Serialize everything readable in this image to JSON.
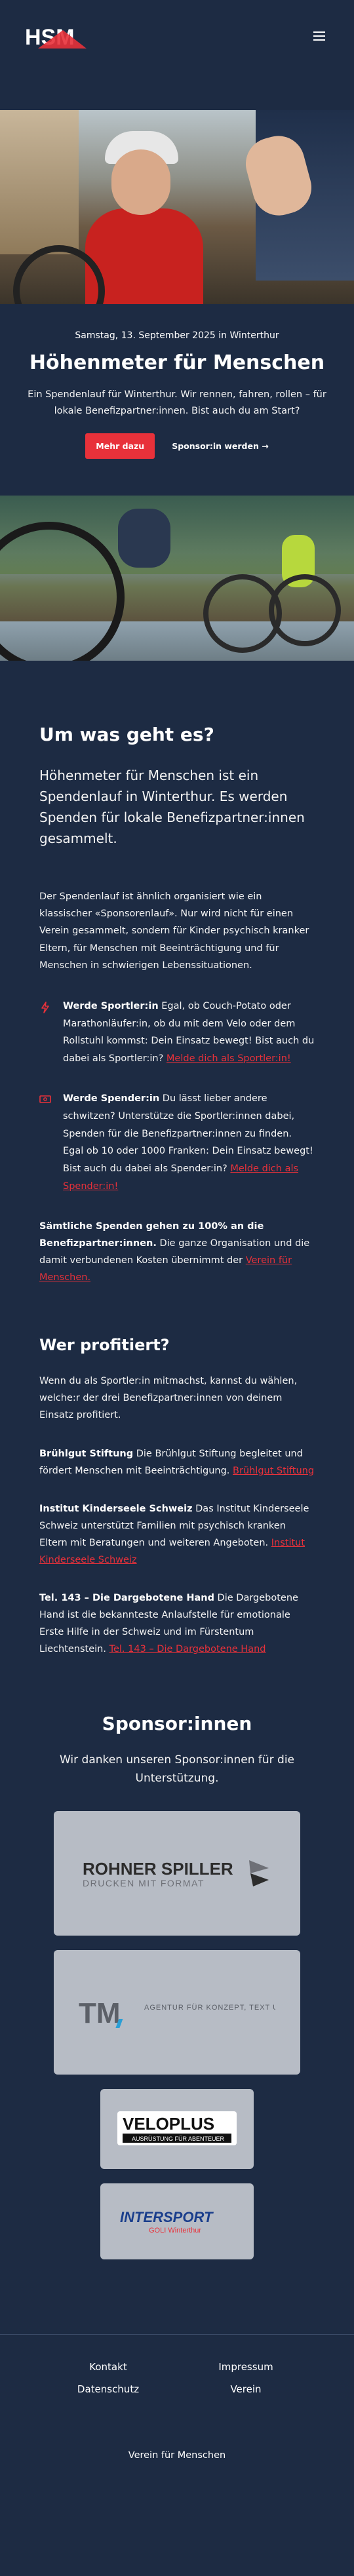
{
  "header": {
    "logo_text": "HSM",
    "menu_icon": "menu-icon"
  },
  "hero": {
    "date": "Samstag, 13. September 2025 in Winterthur",
    "title": "Höhenmeter für Menschen",
    "description": "Ein Spendenlauf für Winterthur. Wir rennen, fahren, rollen – für lokale Benefizpartner:innen. Bist auch du am Start?",
    "primary_cta": "Mehr dazu",
    "secondary_cta": "Sponsor:in werden →"
  },
  "intro": {
    "heading": "Um was geht es?",
    "lead": "Höhenmeter für Menschen ist ein Spendenlauf in Winterthur. Es werden Spenden für lokale Benefizpartner:innen gesammelt.",
    "paragraph": "Der Spendenlauf ist ähnlich organisiert wie ein klassischer «Sponsorenlauf». Nur wird nicht für einen Verein gesammelt, sondern für Kinder psychisch kranker Eltern, für Menschen mit Beeinträchtigung und für Menschen in schwierigen Lebenssituationen.",
    "features": [
      {
        "icon": "lightning-icon",
        "title": "Werde Sportler:in",
        "text": " Egal, ob Couch-Potato oder Marathonläufer:in, ob du mit dem Velo oder dem Rollstuhl kommst: Dein Einsatz bewegt! Bist auch du dabei als Sportler:in? ",
        "link": "Melde dich als Sportler:in!"
      },
      {
        "icon": "money-icon",
        "title": "Werde Spender:in",
        "text": " Du lässt lieber andere schwitzen? Unterstütze die Sportler:innen dabei, Spenden für die Benefizpartner:innen zu finden. Egal ob 10 oder 1000 Franken: Dein Einsatz bewegt! Bist auch du dabei als Spender:in? ",
        "link": "Melde dich als Spender:in!"
      }
    ],
    "note_bold": "Sämtliche Spenden gehen zu 100% an die Benefizpartner:innen.",
    "note_text": " Die ganze Organisation und die damit verbundenen Kosten übernimmt der ",
    "note_link": "Verein für Menschen."
  },
  "beneficiaries": {
    "heading": "Wer profitiert?",
    "intro": "Wenn du als Sportler:in mitmachst, kannst du wählen, welche:r der drei Benefizpartner:innen von deinem Einsatz profitiert.",
    "items": [
      {
        "name": "Brühlgut Stiftung",
        "text": " Die Brühlgut Stiftung begleitet und fördert Menschen mit Beeinträchtigung. ",
        "link": "Brühlgut Stiftung"
      },
      {
        "name": "Institut Kinderseele Schweiz",
        "text": " Das Institut Kinderseele Schweiz unterstützt Familien mit psychisch kranken Eltern mit Beratungen und weiteren Angeboten. ",
        "link": "Institut Kinderseele Schweiz"
      },
      {
        "name": "Tel. 143 – Die Dargebotene Hand",
        "text": " Die Dargebotene Hand ist die bekannteste Anlaufstelle für emotionale Erste Hilfe in der Schweiz und im Fürstentum Liechtenstein. ",
        "link": "Tel. 143 – Die Dargebotene Hand"
      }
    ]
  },
  "sponsors": {
    "heading": "Sponsor:innen",
    "subtitle": "Wir danken unseren Sponsor:innen für die Unterstützung.",
    "logos": [
      {
        "name": "ROHNER SPILLER",
        "tagline": "DRUCKEN MIT FORMAT"
      },
      {
        "name": "TM",
        "tagline": "AGENTUR FÜR KONZEPT, TEXT UND DESIGN"
      },
      {
        "name": "VELOPLUS",
        "tagline": "AUSRÜSTUNG FÜR ABENTEUER"
      },
      {
        "name": "INTERSPORT",
        "tagline": "GOLI Winterthur"
      }
    ]
  },
  "footer": {
    "links": [
      "Kontakt",
      "Impressum",
      "Datenschutz",
      "Verein"
    ],
    "bottom": "Verein für Menschen"
  },
  "colors": {
    "background": "#1d2b43",
    "accent": "#e8313a"
  }
}
